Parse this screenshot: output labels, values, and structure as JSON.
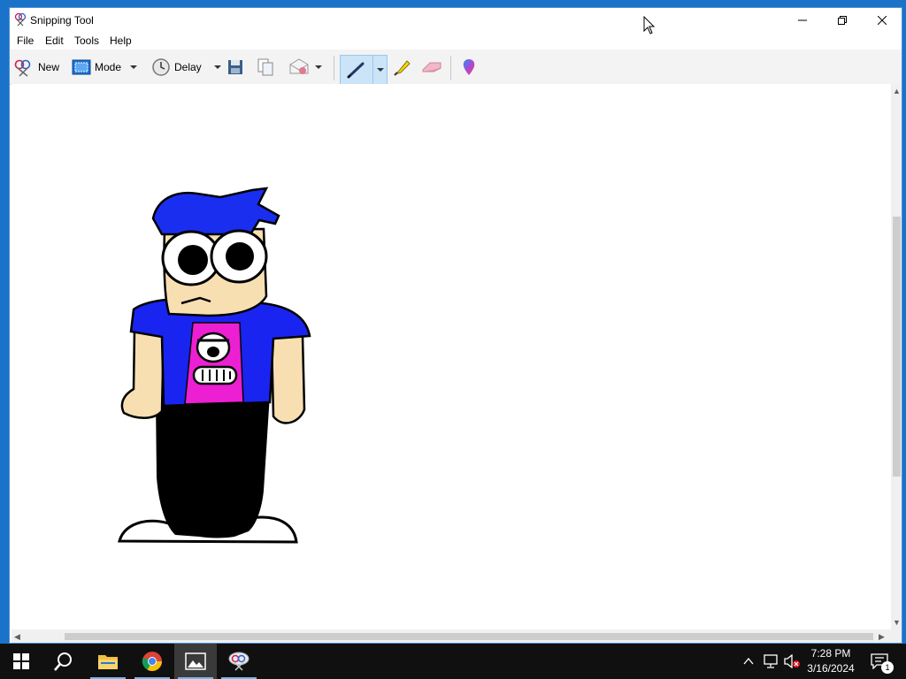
{
  "window": {
    "title": "Snipping Tool",
    "controls": {
      "minimize": "minimize",
      "restore": "restore",
      "close": "close"
    }
  },
  "menu": [
    "File",
    "Edit",
    "Tools",
    "Help"
  ],
  "toolbar": {
    "new_label": "New",
    "mode_label": "Mode",
    "delay_label": "Delay",
    "icons": [
      "scissors-icon",
      "mode-rect-icon",
      "clock-icon",
      "save-icon",
      "copy-icon",
      "send-icon",
      "pen-icon",
      "highlighter-icon",
      "eraser-icon",
      "paint3d-icon"
    ]
  },
  "canvas": {
    "image": "pixel-art character: blue spiky hair, big eyes, blue jacket, pink shirt, black pants, white shoes"
  },
  "taskbar": {
    "apps": [
      "start-icon",
      "search-icon",
      "file-explorer-icon",
      "chrome-icon",
      "photos-icon",
      "snipping-tool-icon"
    ],
    "time": "7:28 PM",
    "date": "3/16/2024",
    "notification_count": "1"
  },
  "colors": {
    "title_bg": "#ffffff",
    "toolbar_bg": "#f3f3f3",
    "pen_selected_bg": "#cce4f7",
    "taskbar_bg": "#101010",
    "desktop": "#1a73c9"
  }
}
